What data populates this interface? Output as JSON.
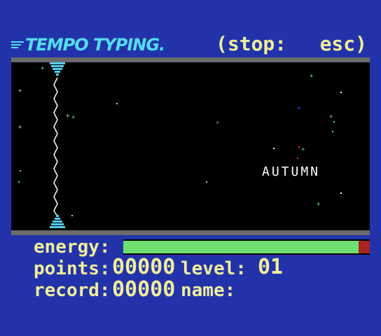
{
  "logo": {
    "text": "Tempo Typing."
  },
  "stop_hint": {
    "label": "(stop:",
    "key": "esc)"
  },
  "game": {
    "current_word": "AUTUMN"
  },
  "hud": {
    "energy_label": "energy:",
    "energy_level": 0.95,
    "points_label": "points:",
    "points_value": "00000",
    "level_label": "level:",
    "level_value": "01",
    "record_label": "record:",
    "record_value": "00000",
    "name_label": "name:",
    "name_value": ""
  },
  "colors": {
    "background": "#2233aa",
    "logo": "#55ddee",
    "hud_text": "#f1ee9a",
    "energy_fill": "#6fe06f",
    "energy_cap": "#aa2222",
    "playfield": "#000000",
    "border": "#6b6b6b"
  }
}
